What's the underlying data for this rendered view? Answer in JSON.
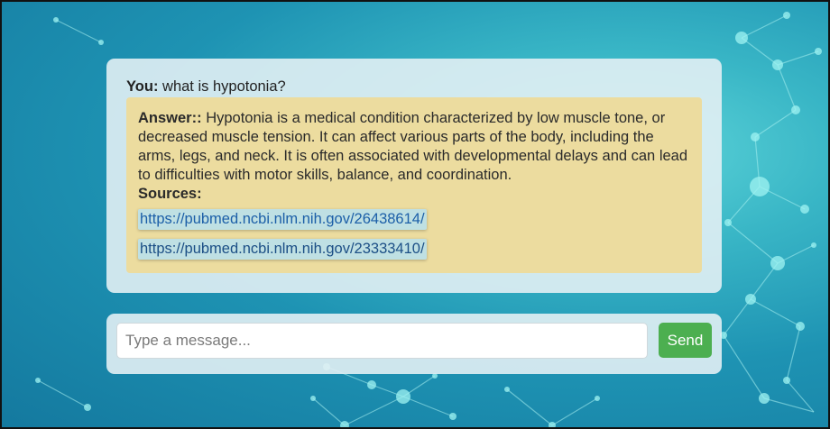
{
  "conversation": {
    "user_label": "You:",
    "user_message": "what is hypotonia?",
    "answer_label": "Answer::",
    "answer_text": "Hypotonia is a medical condition characterized by low muscle tone, or decreased muscle tension. It can affect various parts of the body, including the arms, legs, and neck. It is often associated with developmental delays and can lead to difficulties with motor skills, balance, and coordination.",
    "sources_label": "Sources:",
    "sources": [
      "https://pubmed.ncbi.nlm.nih.gov/26438614/",
      "https://pubmed.ncbi.nlm.nih.gov/23333410/"
    ]
  },
  "composer": {
    "placeholder": "Type a message...",
    "send_label": "Send"
  },
  "colors": {
    "answer_background": "#ecdc9f",
    "send_button": "#4caf50",
    "link": "#1c5fa8"
  },
  "background": {
    "icon": "molecular-network-background"
  }
}
